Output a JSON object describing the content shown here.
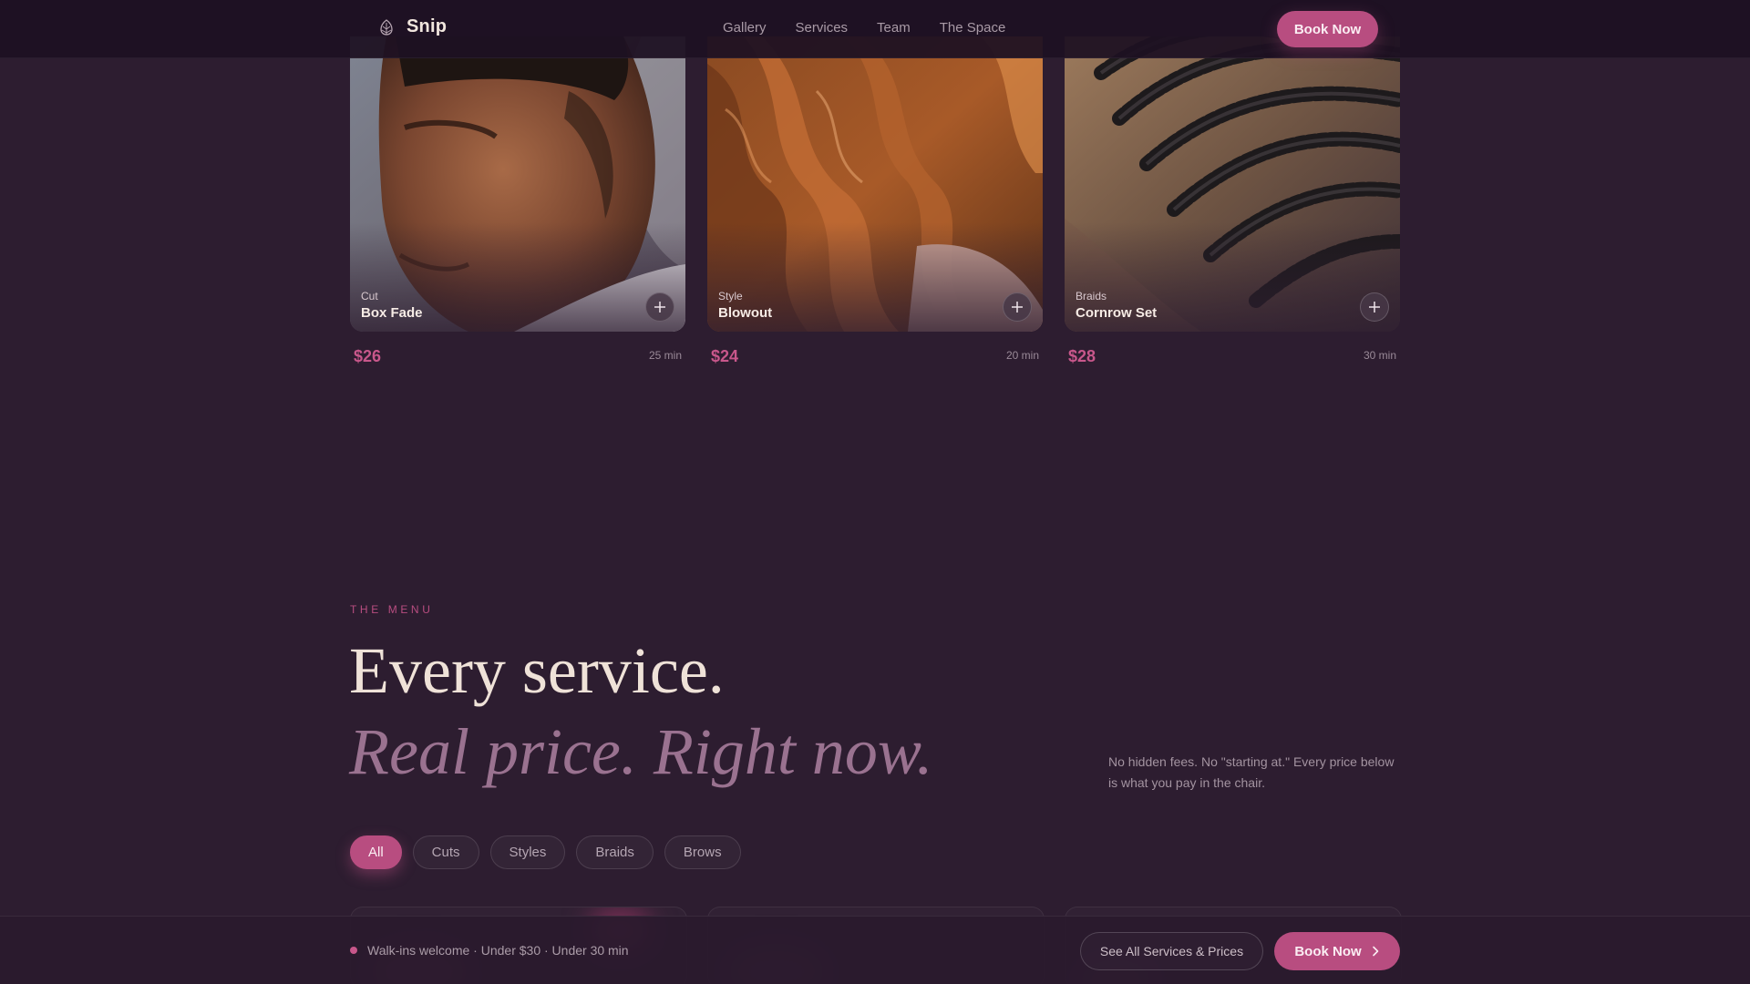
{
  "brand": {
    "name": "Snip",
    "icon": "pinecone-icon"
  },
  "nav": {
    "links": [
      "Gallery",
      "Services",
      "Team",
      "The Space"
    ],
    "book_label": "Book Now"
  },
  "services": [
    {
      "category": "Cut",
      "title": "Box Fade",
      "price": "$26",
      "duration": "25 min"
    },
    {
      "category": "Style",
      "title": "Blowout",
      "price": "$24",
      "duration": "20 min"
    },
    {
      "category": "Braids",
      "title": "Cornrow Set",
      "price": "$28",
      "duration": "30 min"
    }
  ],
  "menu": {
    "eyebrow": "THE MENU",
    "headline": "Every service.",
    "headline_italic": "Real price. Right now.",
    "note": "No hidden fees. No \"starting at.\" Every price below is what you pay in the chair.",
    "filters": [
      "All",
      "Cuts",
      "Styles",
      "Braids",
      "Brows"
    ],
    "active_filter": "All"
  },
  "bottom_bar": {
    "walkin_text": "Walk-ins welcome · Under $30 · Under 30 min",
    "see_all_label": "See All Services & Prices",
    "book_label": "Book Now"
  },
  "colors": {
    "background": "#2d1d30",
    "accent": "#b84d80",
    "price": "#c8578b",
    "headline": "#efe2d8",
    "headline_italic": "#9a7290"
  }
}
